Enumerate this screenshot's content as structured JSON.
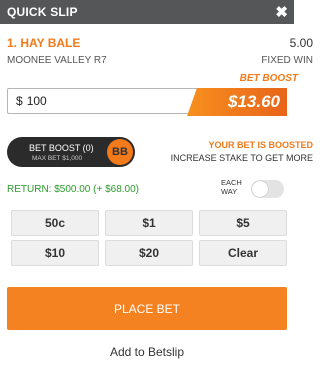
{
  "header": {
    "title": "QUICK SLIP",
    "close_symbol": "✖"
  },
  "runner": {
    "name": "1. HAY BALE",
    "odds": "5.00",
    "race": "MOONEE VALLEY R7",
    "bet_type": "FIXED WIN"
  },
  "boost": {
    "label": "BET BOOST",
    "amount": "$13.60"
  },
  "stake": {
    "currency": "$",
    "value": "100"
  },
  "boost_toggle": {
    "title": "BET BOOST (0)",
    "subtitle": "MAX BET $1,000",
    "badge": "BB"
  },
  "boost_message": {
    "line1": "YOUR BET IS BOOSTED",
    "line2": "INCREASE STAKE TO GET MORE"
  },
  "returns": {
    "text": "RETURN: $500.00 (+ $68.00)"
  },
  "each_way": {
    "line1": "EACH",
    "line2": "WAY"
  },
  "quick_stakes": [
    "50c",
    "$1",
    "$5",
    "$10",
    "$20",
    "Clear"
  ],
  "actions": {
    "place_bet": "PLACE BET",
    "add_to_betslip": "Add to Betslip"
  },
  "colors": {
    "accent": "#f27a1a",
    "header_bg": "#555657",
    "return_green": "#2a9d2a"
  }
}
